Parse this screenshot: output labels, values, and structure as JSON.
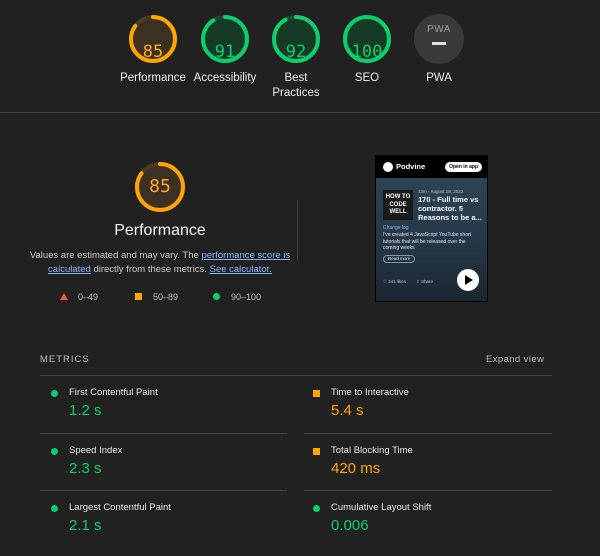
{
  "gauges": [
    {
      "key": "performance",
      "score": "85",
      "label": "Performance",
      "fraction": 0.85,
      "color": "#ffa400"
    },
    {
      "key": "accessibility",
      "score": "91",
      "label": "Accessibility",
      "fraction": 0.91,
      "color": "#0cce6b"
    },
    {
      "key": "best-practices",
      "score": "92",
      "label": "Best Practices",
      "fraction": 0.92,
      "color": "#0cce6b"
    },
    {
      "key": "seo",
      "score": "100",
      "label": "SEO",
      "fraction": 1.0,
      "color": "#0cce6b"
    }
  ],
  "pwa": {
    "badge_text": "PWA",
    "label": "PWA"
  },
  "performance": {
    "score": "85",
    "fraction": 0.85,
    "title": "Performance",
    "desc_prefix": "Values are estimated and may vary. The ",
    "desc_link1": "performance score is calculated",
    "desc_middle": " directly from these metrics. ",
    "desc_link2": "See calculator."
  },
  "legend": {
    "fail": "0–49",
    "average": "50–89",
    "pass": "90–100"
  },
  "preview": {
    "brand": "Podvine",
    "open_btn": "Open in app",
    "thumb_text": "HOW TO CODE WELL",
    "meta": "13m · August 18, 2022",
    "episode": "170 - Full time vs contractor. 5 Reasons to be a...",
    "changelog": "Change log",
    "description": "I've created 4 JavaScript YouTube short tutorials that will be released over the coming weeks",
    "read_more": "Read more",
    "likes": "241 likes",
    "share": "Share"
  },
  "metrics_section": {
    "title": "METRICS",
    "expand": "Expand view"
  },
  "metrics": [
    {
      "name": "First Contentful Paint",
      "value": "1.2 s",
      "status": "good"
    },
    {
      "name": "Time to Interactive",
      "value": "5.4 s",
      "status": "avg"
    },
    {
      "name": "Speed Index",
      "value": "2.3 s",
      "status": "good"
    },
    {
      "name": "Total Blocking Time",
      "value": "420 ms",
      "status": "avg"
    },
    {
      "name": "Largest Contentful Paint",
      "value": "2.1 s",
      "status": "good"
    },
    {
      "name": "Cumulative Layout Shift",
      "value": "0.006",
      "status": "good"
    }
  ],
  "colors": {
    "pass": "#0cce6b",
    "average": "#ffa400",
    "fail": "#ff4e42",
    "link": "#8ab4f8"
  }
}
